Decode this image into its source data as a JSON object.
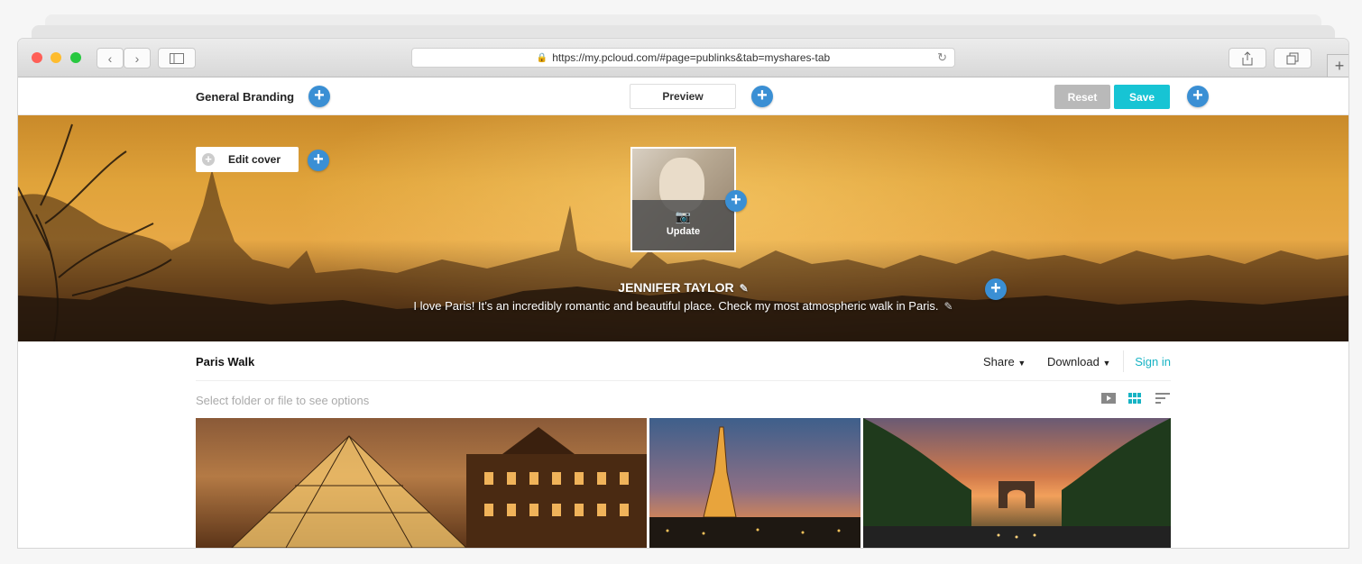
{
  "browser": {
    "url": "https://my.pcloud.com/#page=publinks&tab=myshares-tab",
    "traffic_lights": {
      "close": "#ff5f57",
      "minimize": "#febc2e",
      "zoom": "#28c840"
    },
    "icons": {
      "back": "chevron-left-icon",
      "forward": "chevron-right-icon",
      "sidebar": "sidebar-icon",
      "lock": "lock-icon",
      "reload": "reload-icon",
      "share": "share-icon",
      "tabs": "tabs-icon",
      "new_tab": "plus-icon"
    }
  },
  "branding_bar": {
    "title": "General Branding",
    "preview_label": "Preview",
    "reset_label": "Reset",
    "save_label": "Save"
  },
  "cover": {
    "edit_cover_label": "Edit cover",
    "avatar_update_label": "Update",
    "name": "JENNIFER TAYLOR",
    "bio": "I love Paris! It’s an incredibly romantic and beautiful place. Check my most atmospheric walk in Paris."
  },
  "folder": {
    "title": "Paris Walk",
    "share_label": "Share",
    "download_label": "Download",
    "signin_label": "Sign in",
    "hint": "Select folder or file to see options"
  },
  "colors": {
    "accent": "#17c4d4",
    "plus_badge": "#3a8fd4",
    "reset_gray": "#b9b9b9"
  }
}
